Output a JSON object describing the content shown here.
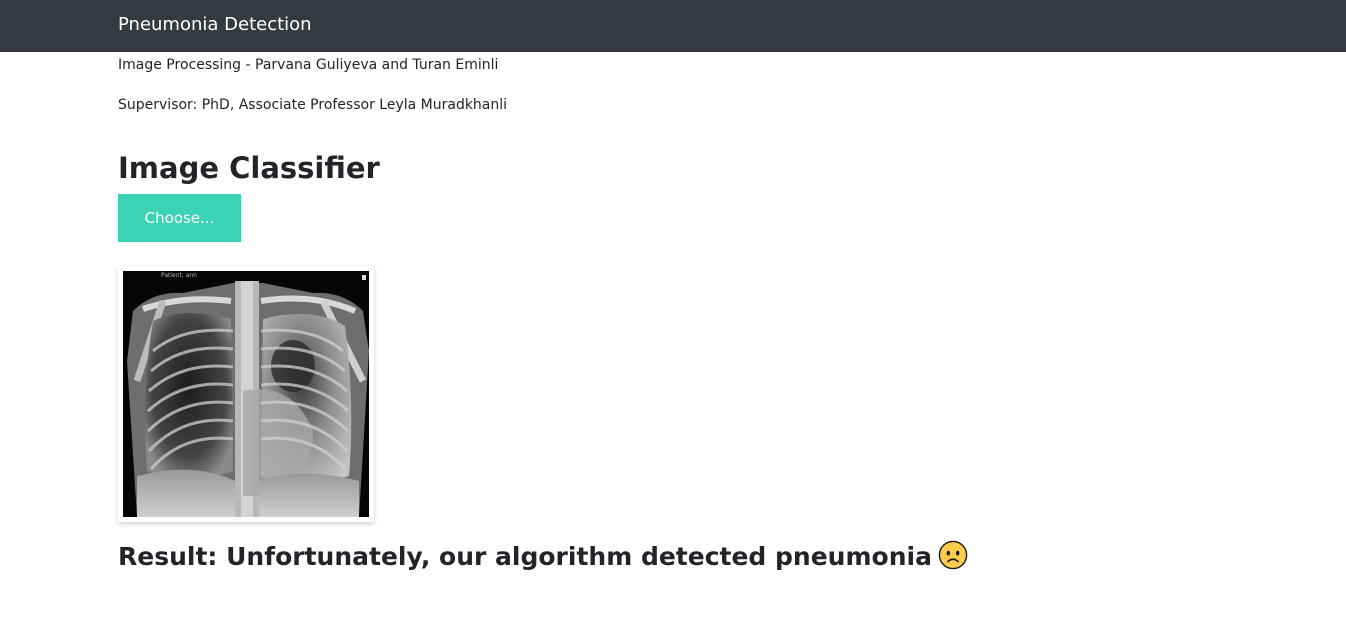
{
  "navbar": {
    "brand": "Pneumonia Detection"
  },
  "header": {
    "authors_line": "Image Processing - Parvana Guliyeva and Turan Eminli",
    "supervisor_line": "Supervisor: PhD, Associate Professor Leyla Muradkhanli"
  },
  "classifier": {
    "title": "Image Classifier",
    "choose_button_label": "Choose...",
    "image_icon": "chest-xray-image",
    "image_corner_text": "Patient, ann"
  },
  "result": {
    "text": "Result: Unfortunately, our algorithm detected pneumonia",
    "emoji_icon": "worried-face-icon"
  },
  "colors": {
    "navbar_bg": "#343a40",
    "button_bg": "#3cd2b5",
    "text": "#212529"
  }
}
